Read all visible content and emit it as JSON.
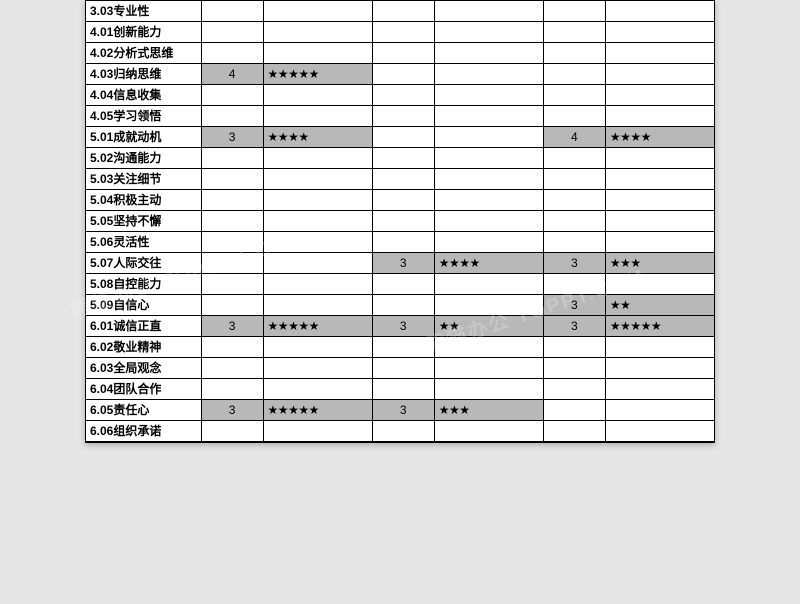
{
  "watermark": "熊猫办公 TOPPT.COM",
  "rows": [
    {
      "label": "3.03专业性",
      "c1": "",
      "c2": "",
      "c3": "",
      "c4": "",
      "c5": "",
      "c6": "",
      "sh": ""
    },
    {
      "label": "4.01创新能力",
      "c1": "",
      "c2": "",
      "c3": "",
      "c4": "",
      "c5": "",
      "c6": "",
      "sh": ""
    },
    {
      "label": "4.02分析式思维",
      "c1": "",
      "c2": "",
      "c3": "",
      "c4": "",
      "c5": "",
      "c6": "",
      "sh": ""
    },
    {
      "label": "4.03归纳思维",
      "c1": "4",
      "c2": "★★★★★",
      "c3": "",
      "c4": "",
      "c5": "",
      "c6": "",
      "sh": "12"
    },
    {
      "label": "4.04信息收集",
      "c1": "",
      "c2": "",
      "c3": "",
      "c4": "",
      "c5": "",
      "c6": "",
      "sh": ""
    },
    {
      "label": "4.05学习领悟",
      "c1": "",
      "c2": "",
      "c3": "",
      "c4": "",
      "c5": "",
      "c6": "",
      "sh": ""
    },
    {
      "label": "5.01成就动机",
      "c1": "3",
      "c2": "★★★★",
      "c3": "",
      "c4": "",
      "c5": "4",
      "c6": "★★★★",
      "sh": "1256"
    },
    {
      "label": "5.02沟通能力",
      "c1": "",
      "c2": "",
      "c3": "",
      "c4": "",
      "c5": "",
      "c6": "",
      "sh": ""
    },
    {
      "label": "5.03关注细节",
      "c1": "",
      "c2": "",
      "c3": "",
      "c4": "",
      "c5": "",
      "c6": "",
      "sh": ""
    },
    {
      "label": "5.04积极主动",
      "c1": "",
      "c2": "",
      "c3": "",
      "c4": "",
      "c5": "",
      "c6": "",
      "sh": ""
    },
    {
      "label": "5.05坚持不懈",
      "c1": "",
      "c2": "",
      "c3": "",
      "c4": "",
      "c5": "",
      "c6": "",
      "sh": ""
    },
    {
      "label": "5.06灵活性",
      "c1": "",
      "c2": "",
      "c3": "",
      "c4": "",
      "c5": "",
      "c6": "",
      "sh": ""
    },
    {
      "label": "5.07人际交往",
      "c1": "",
      "c2": "",
      "c3": "3",
      "c4": "★★★★",
      "c5": "3",
      "c6": "★★★",
      "sh": "3456"
    },
    {
      "label": "5.08自控能力",
      "c1": "",
      "c2": "",
      "c3": "",
      "c4": "",
      "c5": "",
      "c6": "",
      "sh": ""
    },
    {
      "label": "5.09自信心",
      "c1": "",
      "c2": "",
      "c3": "",
      "c4": "",
      "c5": "3",
      "c6": "★★",
      "sh": "56"
    },
    {
      "label": "6.01诚信正直",
      "c1": "3",
      "c2": "★★★★★",
      "c3": "3",
      "c4": "★★",
      "c5": "3",
      "c6": "★★★★★",
      "sh": "123456"
    },
    {
      "label": "6.02敬业精神",
      "c1": "",
      "c2": "",
      "c3": "",
      "c4": "",
      "c5": "",
      "c6": "",
      "sh": ""
    },
    {
      "label": "6.03全局观念",
      "c1": "",
      "c2": "",
      "c3": "",
      "c4": "",
      "c5": "",
      "c6": "",
      "sh": ""
    },
    {
      "label": "6.04团队合作",
      "c1": "",
      "c2": "",
      "c3": "",
      "c4": "",
      "c5": "",
      "c6": "",
      "sh": ""
    },
    {
      "label": "6.05责任心",
      "c1": "3",
      "c2": "★★★★★",
      "c3": "3",
      "c4": "★★★",
      "c5": "",
      "c6": "",
      "sh": "1234"
    },
    {
      "label": "6.06组织承诺",
      "c1": "",
      "c2": "",
      "c3": "",
      "c4": "",
      "c5": "",
      "c6": "",
      "sh": ""
    }
  ]
}
